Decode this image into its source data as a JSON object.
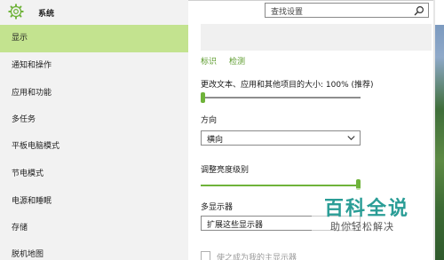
{
  "window": {
    "title": "系统"
  },
  "search": {
    "placeholder": "查找设置"
  },
  "sidebar": {
    "items": [
      {
        "label": "显示",
        "active": true
      },
      {
        "label": "通知和操作",
        "active": false
      },
      {
        "label": "应用和功能",
        "active": false
      },
      {
        "label": "多任务",
        "active": false
      },
      {
        "label": "平板电脑模式",
        "active": false
      },
      {
        "label": "节电模式",
        "active": false
      },
      {
        "label": "电源和睡眠",
        "active": false
      },
      {
        "label": "存储",
        "active": false
      },
      {
        "label": "脱机地图",
        "active": false
      }
    ]
  },
  "display": {
    "identify_link": "标识",
    "detect_link": "检测",
    "scale_label": "更改文本、应用和其他项目的大小: 100% (推荐)",
    "scale_level": 0.0,
    "orientation_label": "方向",
    "orientation_value": "横向",
    "brightness_label": "调整亮度级别",
    "brightness_level": 1.0,
    "multi_display_label": "多显示器",
    "multi_display_value": "扩展这些显示器",
    "main_display_checkbox": "使之成为我的主显示器",
    "main_display_checked": false
  },
  "watermark": {
    "main": "百科全说",
    "sub": "助你轻松解决"
  },
  "colors": {
    "accent": "#6fb33a",
    "sidebar_active": "#c3e38f",
    "sidebar_bg": "#f2f2f2",
    "link": "#5a9a2a"
  }
}
